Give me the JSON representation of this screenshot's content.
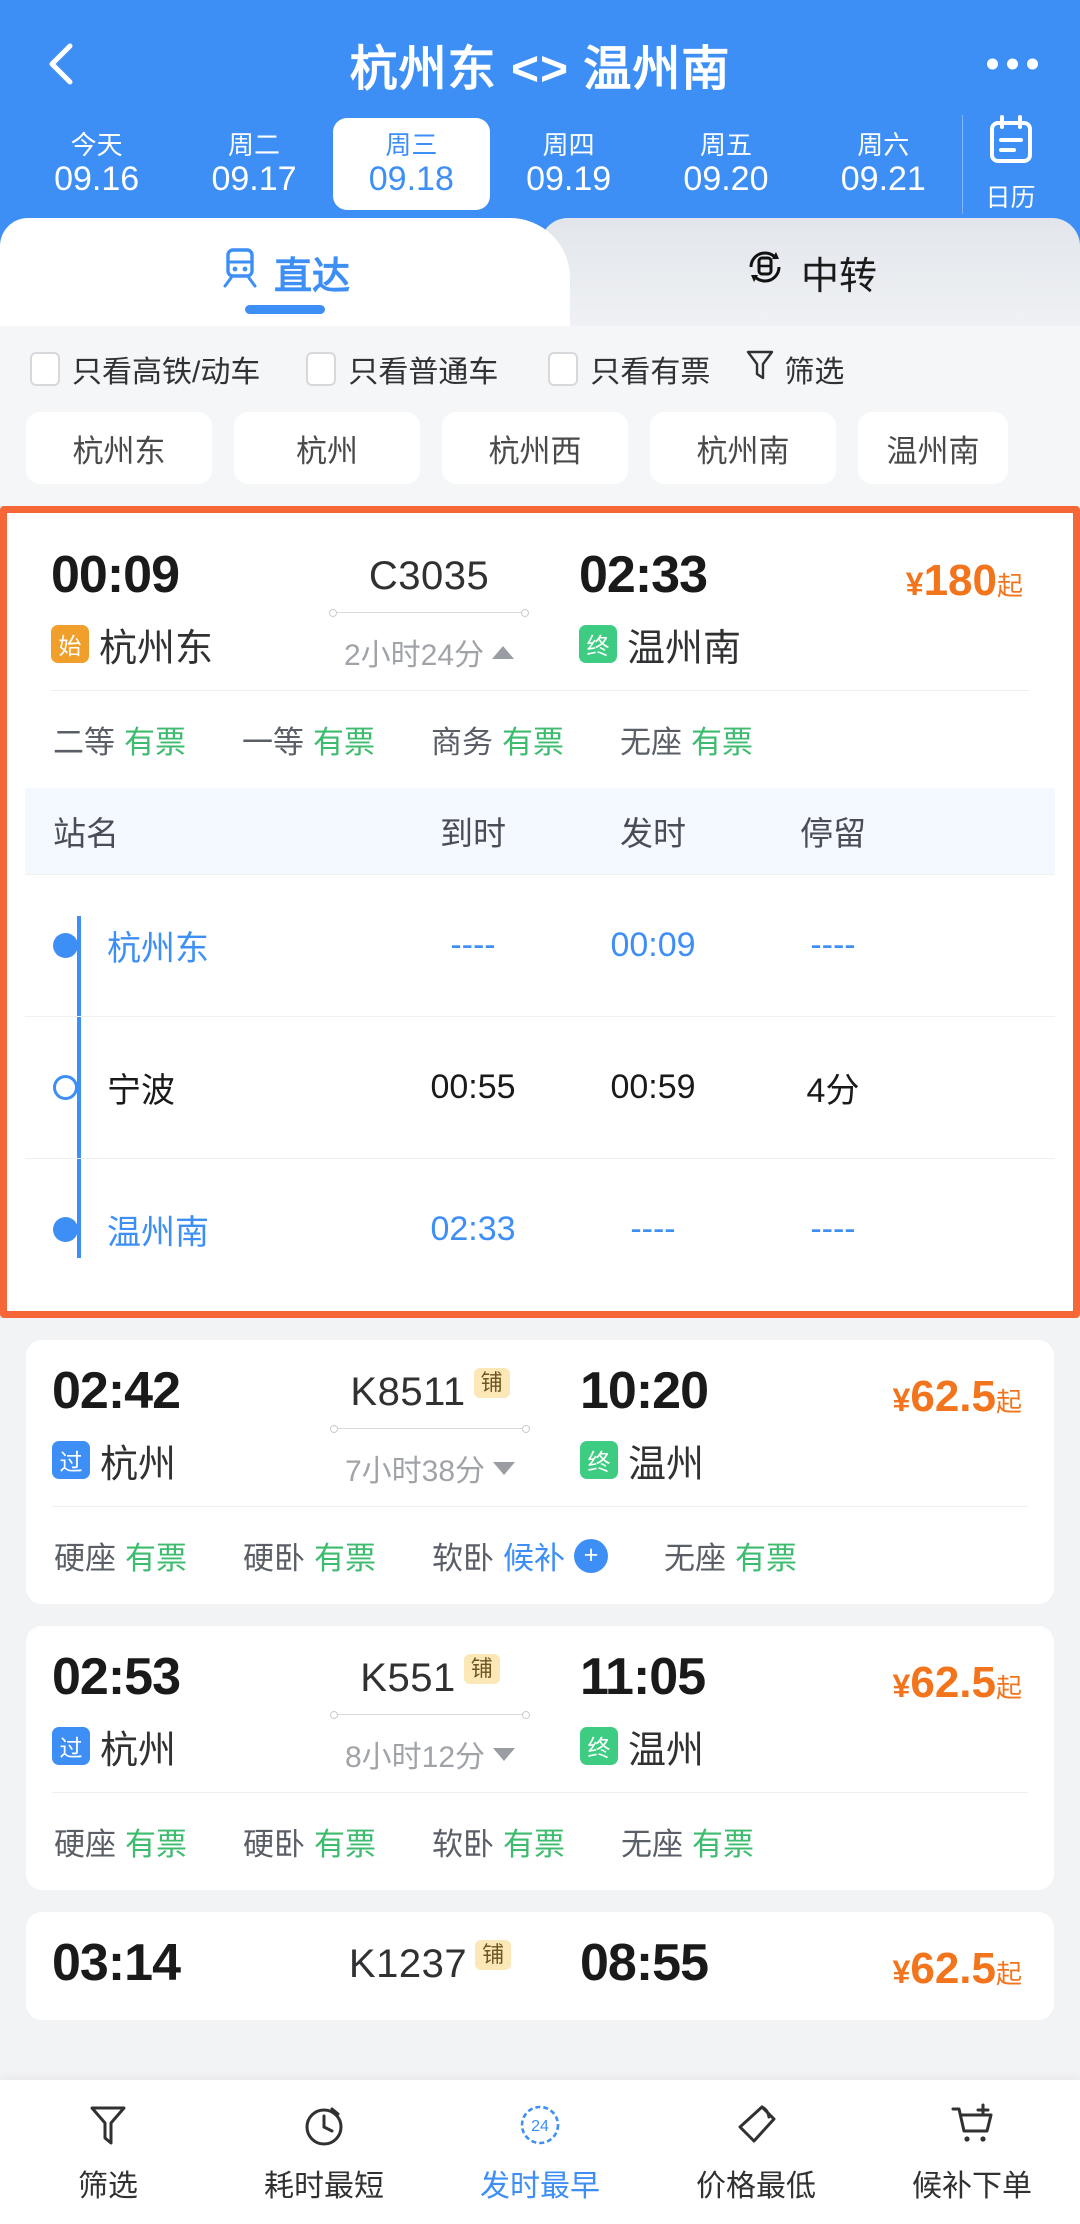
{
  "header": {
    "back_icon": "chevron-left-icon",
    "title": "杭州东 <> 温州南",
    "more_icon": "more-options-icon",
    "calendar": {
      "icon": "calendar-icon",
      "label": "日历"
    },
    "dates": [
      {
        "weekday": "今天",
        "date": "09.16",
        "active": false
      },
      {
        "weekday": "周二",
        "date": "09.17",
        "active": false
      },
      {
        "weekday": "周三",
        "date": "09.18",
        "active": true
      },
      {
        "weekday": "周四",
        "date": "09.19",
        "active": false
      },
      {
        "weekday": "周五",
        "date": "09.20",
        "active": false
      },
      {
        "weekday": "周六",
        "date": "09.21",
        "active": false
      }
    ]
  },
  "tabs": [
    {
      "label": "直达",
      "icon": "train-icon",
      "active": true
    },
    {
      "label": "中转",
      "icon": "transfer-train-icon",
      "active": false
    }
  ],
  "filters": {
    "checkboxes": [
      {
        "label": "只看高铁/动车",
        "checked": false
      },
      {
        "label": "只看普通车",
        "checked": false
      },
      {
        "label": "只看有票",
        "checked": false
      }
    ],
    "filter_button": {
      "label": "筛选",
      "icon": "funnel-icon"
    },
    "station_chips": [
      "杭州东",
      "杭州",
      "杭州西",
      "杭州南",
      "温州南"
    ]
  },
  "schedule_table": {
    "headers": {
      "station": "站名",
      "arrive": "到时",
      "depart": "发时",
      "stay": "停留"
    },
    "rows": [
      {
        "station": "杭州东",
        "arrive": "----",
        "depart": "00:09",
        "stay": "----",
        "marker": "full",
        "highlight": true
      },
      {
        "station": "宁波",
        "arrive": "00:55",
        "depart": "00:59",
        "stay": "4分",
        "marker": "open",
        "highlight": false
      },
      {
        "station": "温州南",
        "arrive": "02:33",
        "depart": "----",
        "stay": "----",
        "marker": "full",
        "highlight": true
      }
    ]
  },
  "trains": [
    {
      "depart_time": "00:09",
      "depart_station": "杭州东",
      "depart_badge": "始",
      "depart_badge_type": "start",
      "train_no": "C3035",
      "bed_badge": "",
      "duration": "2小时24分",
      "expand_state": "expanded",
      "arrive_time": "02:33",
      "arrive_station": "温州南",
      "arrive_badge": "终",
      "arrive_badge_type": "end",
      "price_currency": "¥",
      "price": "180",
      "price_suffix": "起",
      "seats": [
        {
          "type": "二等",
          "status": "有票",
          "status_kind": "available"
        },
        {
          "type": "一等",
          "status": "有票",
          "status_kind": "available"
        },
        {
          "type": "商务",
          "status": "有票",
          "status_kind": "available"
        },
        {
          "type": "无座",
          "status": "有票",
          "status_kind": "available"
        }
      ],
      "selected": true
    },
    {
      "depart_time": "02:42",
      "depart_station": "杭州",
      "depart_badge": "过",
      "depart_badge_type": "pass",
      "train_no": "K8511",
      "bed_badge": "铺",
      "duration": "7小时38分",
      "expand_state": "collapsed",
      "arrive_time": "10:20",
      "arrive_station": "温州",
      "arrive_badge": "终",
      "arrive_badge_type": "end",
      "price_currency": "¥",
      "price": "62.5",
      "price_suffix": "起",
      "seats": [
        {
          "type": "硬座",
          "status": "有票",
          "status_kind": "available"
        },
        {
          "type": "硬卧",
          "status": "有票",
          "status_kind": "available"
        },
        {
          "type": "软卧",
          "status": "候补",
          "status_kind": "waitlist"
        },
        {
          "type": "无座",
          "status": "有票",
          "status_kind": "available"
        }
      ],
      "selected": false
    },
    {
      "depart_time": "02:53",
      "depart_station": "杭州",
      "depart_badge": "过",
      "depart_badge_type": "pass",
      "train_no": "K551",
      "bed_badge": "铺",
      "duration": "8小时12分",
      "expand_state": "collapsed",
      "arrive_time": "11:05",
      "arrive_station": "温州",
      "arrive_badge": "终",
      "arrive_badge_type": "end",
      "price_currency": "¥",
      "price": "62.5",
      "price_suffix": "起",
      "seats": [
        {
          "type": "硬座",
          "status": "有票",
          "status_kind": "available"
        },
        {
          "type": "硬卧",
          "status": "有票",
          "status_kind": "available"
        },
        {
          "type": "软卧",
          "status": "有票",
          "status_kind": "available"
        },
        {
          "type": "无座",
          "status": "有票",
          "status_kind": "available"
        }
      ],
      "selected": false
    },
    {
      "depart_time": "03:14",
      "train_no": "K1237",
      "bed_badge": "铺",
      "arrive_time": "08:55",
      "price_currency": "¥",
      "price": "62.5",
      "price_suffix": "起",
      "partial": true
    }
  ],
  "bottom_nav": [
    {
      "label": "筛选",
      "icon": "funnel-icon",
      "active": false
    },
    {
      "label": "耗时最短",
      "icon": "stopwatch-icon",
      "active": false
    },
    {
      "label": "发时最早",
      "icon": "clock-24-icon",
      "active": true
    },
    {
      "label": "价格最低",
      "icon": "price-tag-icon",
      "active": false
    },
    {
      "label": "候补下单",
      "icon": "cart-plus-icon",
      "active": false
    }
  ],
  "colors": {
    "brand_blue": "#3D8FF5",
    "highlight_orange": "#F56736",
    "price_orange": "#F2741D",
    "available_green": "#3DBB6E",
    "badge_start": "#F0A02A",
    "badge_end": "#3DCC82",
    "bed_badge_bg": "#FBE8B6"
  }
}
